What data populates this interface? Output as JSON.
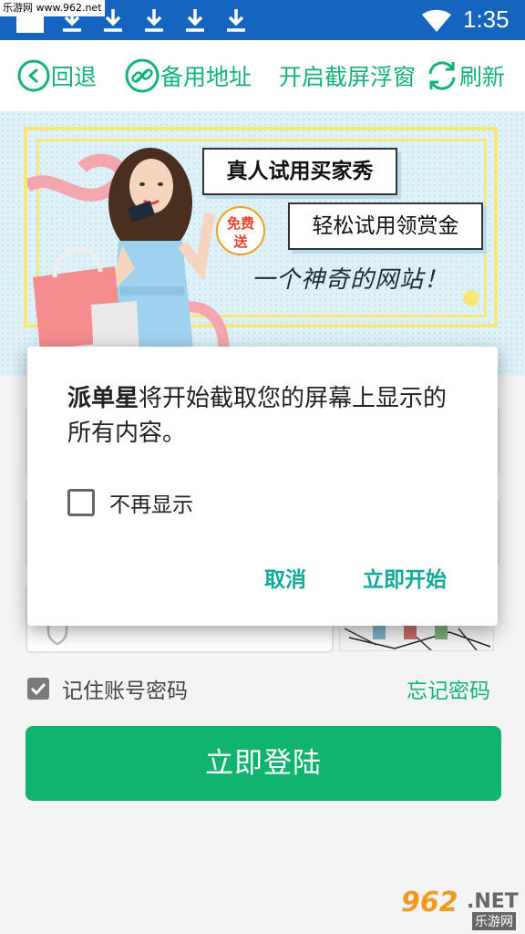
{
  "status_bar": {
    "watermark_top": "乐游网 www.962.net",
    "time": "1:35",
    "icons": [
      "download-icon",
      "download-icon",
      "download-icon",
      "download-icon",
      "download-icon",
      "wifi-icon"
    ]
  },
  "toolbar": {
    "back_label": "回退",
    "backup_label": "备用地址",
    "screen_float_label": "开启截屏浮窗",
    "refresh_label": "刷新",
    "accent_color": "#11b37b"
  },
  "banner": {
    "line1": "真人试用买家秀",
    "line2": "轻松试用领赏金",
    "badge_line1": "免费",
    "badge_line2": "送",
    "slogan": "一个神奇的网站！"
  },
  "login": {
    "remember_label": "记住账号密码",
    "remember_checked": true,
    "forgot_label": "忘记密码",
    "login_button": "立即登陆",
    "button_color": "#11b36e"
  },
  "dialog": {
    "app_name": "派单星",
    "message_rest": "将开始截取您的屏幕上显示的所有内容。",
    "checkbox_label": "不再显示",
    "checkbox_checked": false,
    "cancel_label": "取消",
    "start_label": "立即开始",
    "button_color": "#11a99b"
  },
  "watermark": {
    "num": "962",
    "net": ".NET",
    "site": "乐游网"
  }
}
